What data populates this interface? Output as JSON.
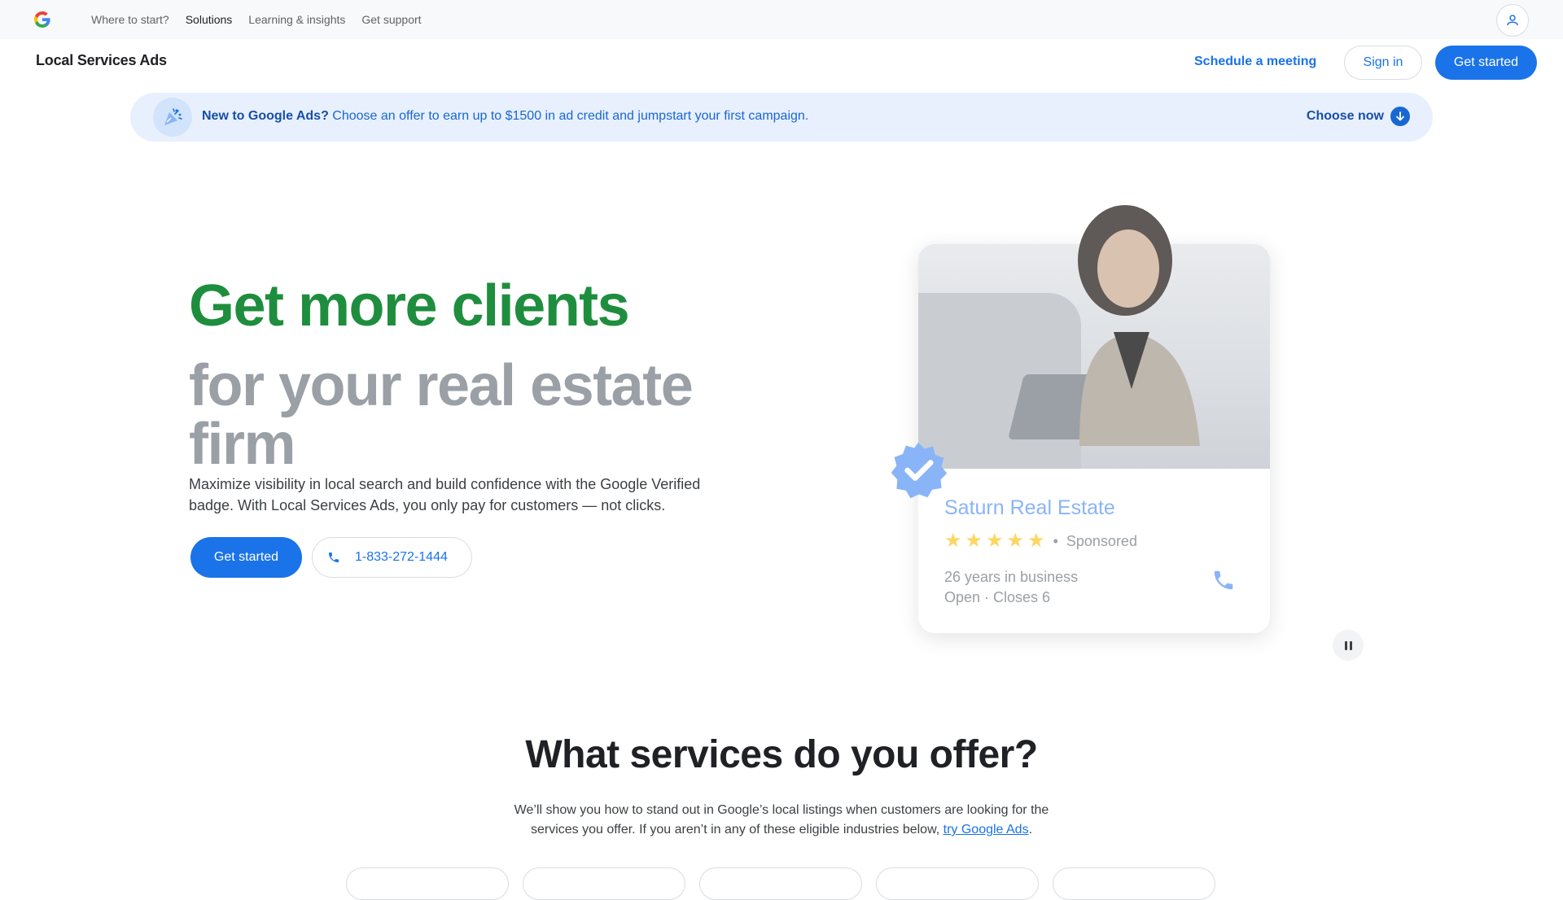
{
  "topbar": {
    "logo_letter": "G",
    "nav": [
      "Where to start?",
      "Solutions",
      "Learning & insights",
      "Get support"
    ],
    "active_index": 1
  },
  "product_header": {
    "title": "Local Services Ads",
    "schedule_label": "Schedule a meeting",
    "signin_label": "Sign in",
    "get_started_label": "Get started"
  },
  "promo": {
    "lead": "New to Google Ads?",
    "text": " Choose an offer to earn up to $1500 in ad credit and jumpstart your first campaign.",
    "cta": "Choose now"
  },
  "hero": {
    "headline": "Get more clients",
    "subheadline": "for your real estate firm",
    "description": "Maximize visibility in local search and build confidence with the Google Verified badge. With Local Services Ads, you only pay for customers — not clicks.",
    "cta_label": "Get started",
    "phone": "1-833-272-1444"
  },
  "listing_card": {
    "business_name": "Saturn Real Estate",
    "rating": 5,
    "stars": "★",
    "separator": "•",
    "sponsored": "Sponsored",
    "years": "26 years in business",
    "hours": "Open · Closes 6"
  },
  "services": {
    "title": "What services do you offer?",
    "description": "We’ll show you how to stand out in Google’s local listings when customers are looking for the services you offer. If you aren’t in any of these eligible industries below, ",
    "link_text": "try Google Ads",
    "tail": "."
  },
  "colors": {
    "brand_blue": "#1a73e8",
    "headline_green": "#1e8e3e",
    "promo_bg": "#e8f0fe",
    "verified_badge": "#8ab4f8"
  },
  "icons": {
    "account": "person-icon",
    "promo": "party-popper-icon",
    "choose": "arrow-down-icon",
    "phone": "phone-icon",
    "badge": "verified-check-icon",
    "pause": "pause-icon"
  }
}
